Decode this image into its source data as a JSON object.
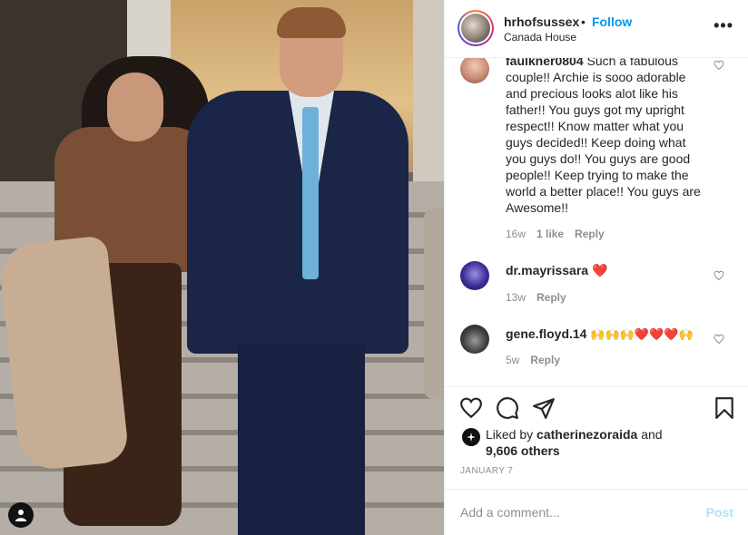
{
  "header": {
    "username": "hrhofsussex",
    "separator": "•",
    "follow_label": "Follow",
    "location": "Canada House",
    "more_label": "•••"
  },
  "comments": [
    {
      "username": "faulkner0804",
      "text": "Such a fabulous couple!! Archie is sooo adorable and precious looks alot like his father!! You guys got my upright respect!! Know matter what you guys decided!! Keep doing what you guys do!! You guys are good people!! Keep trying to make the world a better place!! You guys are Awesome!!",
      "age": "16w",
      "likes": "1 like",
      "reply": "Reply"
    },
    {
      "username": "dr.mayrissara",
      "text": "❤️",
      "age": "13w",
      "reply": "Reply"
    },
    {
      "username": "gene.floyd.14",
      "text": "🙌🙌🙌❤️❤️❤️🙌",
      "age": "5w",
      "reply": "Reply"
    }
  ],
  "likes": {
    "prefix": "Liked by ",
    "user": "catherinezoraida",
    "middle": " and",
    "others": "9,606 others"
  },
  "date": "JANUARY 7",
  "add_comment": {
    "placeholder": "Add a comment...",
    "post_label": "Post"
  },
  "icons": {
    "like": "heart-icon",
    "comment": "comment-bubble-icon",
    "share": "paper-plane-icon",
    "save": "bookmark-icon",
    "user_tag": "person-icon"
  },
  "colors": {
    "follow": "#0095f6",
    "post_disabled": "#b2dffc",
    "heart_emoji": "#e0245e"
  }
}
